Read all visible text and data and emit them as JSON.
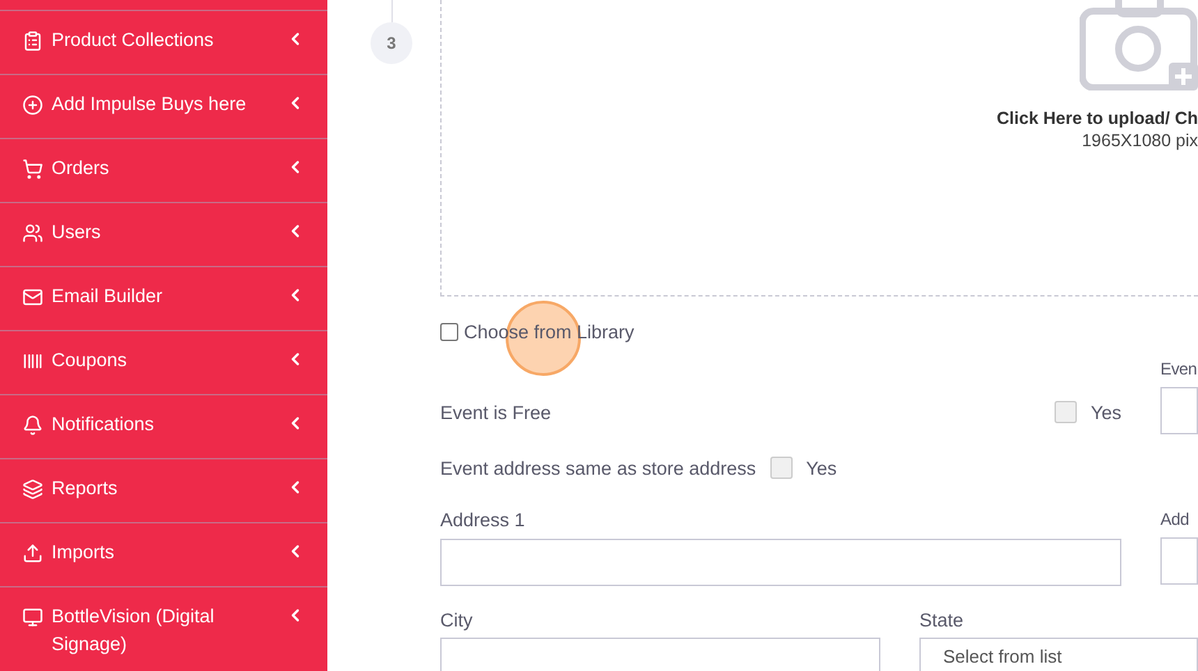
{
  "sidebar": {
    "items": [
      {
        "label": "Product Collections",
        "expanded": false
      },
      {
        "label": "Add Impulse Buys here",
        "expanded": false
      },
      {
        "label": "Orders",
        "expanded": false
      },
      {
        "label": "Users",
        "expanded": false
      },
      {
        "label": "Email Builder",
        "expanded": false
      },
      {
        "label": "Coupons",
        "expanded": false
      },
      {
        "label": "Notifications",
        "expanded": false
      },
      {
        "label": "Reports",
        "expanded": false
      },
      {
        "label": "Imports",
        "expanded": false
      },
      {
        "label": "BottleVision (Digital Signage)",
        "expanded": false
      }
    ]
  },
  "step": {
    "number": "3"
  },
  "upload": {
    "title": "Click Here to upload/ Ch",
    "hint": "1965X1080 pix"
  },
  "library": {
    "label": "Choose from Library",
    "checked": false
  },
  "form": {
    "free": {
      "label": "Event is Free",
      "option": "Yes",
      "checked": false
    },
    "right_label_1": "Even",
    "same_address": {
      "label": "Event address same as store address",
      "option": "Yes",
      "checked": false
    },
    "address1": {
      "label": "Address 1"
    },
    "right_label_2": "Add",
    "city": {
      "label": "City"
    },
    "state": {
      "label": "State",
      "placeholder": "Select from list"
    }
  }
}
